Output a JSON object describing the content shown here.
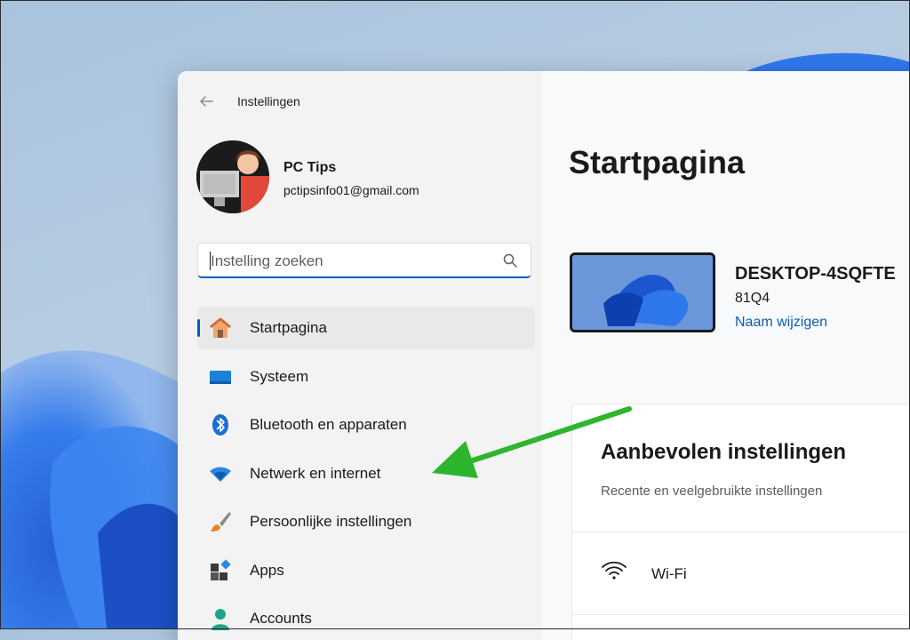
{
  "window": {
    "title": "Instellingen"
  },
  "user": {
    "name": "PC Tips",
    "email": "pctipsinfo01@gmail.com"
  },
  "search": {
    "placeholder": "Instelling zoeken",
    "value": ""
  },
  "sidebar": {
    "items": [
      {
        "label": "Startpagina",
        "icon": "home-icon",
        "active": true
      },
      {
        "label": "Systeem",
        "icon": "monitor-icon",
        "active": false
      },
      {
        "label": "Bluetooth en apparaten",
        "icon": "bluetooth-icon",
        "active": false
      },
      {
        "label": "Netwerk en internet",
        "icon": "wifi-network-icon",
        "active": false
      },
      {
        "label": "Persoonlijke instellingen",
        "icon": "brush-icon",
        "active": false
      },
      {
        "label": "Apps",
        "icon": "apps-icon",
        "active": false
      },
      {
        "label": "Accounts",
        "icon": "account-icon",
        "active": false
      }
    ]
  },
  "main": {
    "title": "Startpagina",
    "device": {
      "name": "DESKTOP-4SQFTE",
      "model": "81Q4",
      "rename_link": "Naam wijzigen"
    },
    "recommended": {
      "title": "Aanbevolen instellingen",
      "subtitle": "Recente en veelgebruikte instellingen",
      "items": [
        {
          "label": "Wi-Fi",
          "icon": "wifi-icon"
        }
      ]
    }
  },
  "colors": {
    "accent": "#005fb8",
    "link": "#0e5cb0",
    "annotation_arrow": "#2db52d"
  }
}
